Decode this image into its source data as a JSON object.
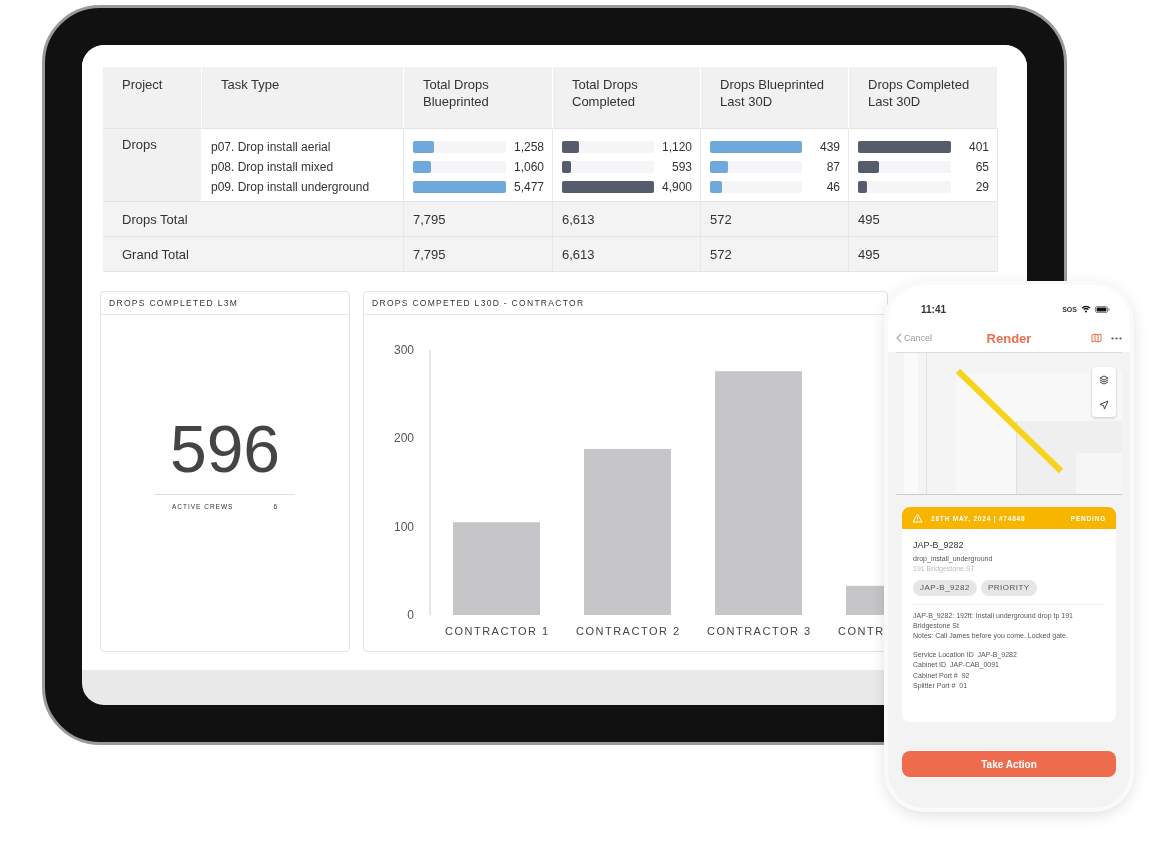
{
  "table": {
    "columns": [
      {
        "label": "Project"
      },
      {
        "label": "Task Type"
      },
      {
        "label": "Total Drops Blueprinted",
        "kind": "blueprinted"
      },
      {
        "label": "Total Drops Completed",
        "kind": "completed"
      },
      {
        "label": "Drops Blueprinted Last 30D",
        "kind": "blueprinted"
      },
      {
        "label": "Drops Completed Last 30D",
        "kind": "completed"
      }
    ],
    "rows": [
      {
        "kind": "detail",
        "project": "Drops",
        "tasks": [
          "p07. Drop install aerial",
          "p08. Drop install mixed",
          "p09. Drop install underground"
        ],
        "metrics": [
          [
            {
              "value": "1,258",
              "level": 0.23
            },
            {
              "value": "1,060",
              "level": 0.19
            },
            {
              "value": "5,477",
              "level": 1
            }
          ],
          [
            {
              "value": "1,120",
              "level": 0.18
            },
            {
              "value": "593",
              "level": 0.1
            },
            {
              "value": "4,900",
              "level": 1
            }
          ],
          [
            {
              "value": "439",
              "level": 1
            },
            {
              "value": "87",
              "level": 0.2
            },
            {
              "value": "46",
              "level": 0.13
            }
          ],
          [
            {
              "value": "401",
              "level": 1
            },
            {
              "value": "65",
              "level": 0.23
            },
            {
              "value": "29",
              "level": 0.1
            }
          ]
        ]
      },
      {
        "kind": "total",
        "label": "Drops Total",
        "values": [
          "7,795",
          "6,613",
          "572",
          "495"
        ]
      },
      {
        "kind": "total",
        "label": "Grand Total",
        "values": [
          "7,795",
          "6,613",
          "572",
          "495"
        ]
      }
    ]
  },
  "kpi_card": {
    "title": "DROPS COMPLETED L3M",
    "value": "596",
    "stat_label": "ACTIVE CREWS",
    "stat_value": "6"
  },
  "chart_card": {
    "title": "DROPS COMPETED L30D - CONTRACTOR",
    "chart_data": {
      "type": "bar",
      "categories": [
        "CONTRACTOR 1",
        "CONTRACTOR 2",
        "CONTRACTOR 3",
        "CONTR"
      ],
      "values": [
        105,
        188,
        276,
        33
      ],
      "ylim": [
        0,
        300
      ],
      "yticks": [
        0,
        100,
        200,
        300
      ]
    }
  },
  "phone": {
    "time": "11:41",
    "carrier": "SOS",
    "back": "Cancel",
    "title": "Render",
    "job": {
      "date": "28TH MAY, 2024 | #74848",
      "status": "PENDING",
      "id": "JAP-B_9282",
      "type": "drop_install_underground",
      "address": "191 Bridgestone ST",
      "tags": [
        "JAP-B_9282",
        "PRIORITY"
      ],
      "description": "JAP-B_9282: 192ft: Install underground drop tp 191 Bridgestone St",
      "notes": "Notes: Call James before you come. Locked gate.",
      "fields": [
        {
          "label": "Service Location ID",
          "value": "JAP-B_9282"
        },
        {
          "label": "Cabinet ID",
          "value": "JAP-CAB_0091"
        },
        {
          "label": "Cabinet Port #",
          "value": "92"
        },
        {
          "label": "Splitter Port #",
          "value": "01"
        }
      ]
    },
    "action": "Take Action"
  }
}
